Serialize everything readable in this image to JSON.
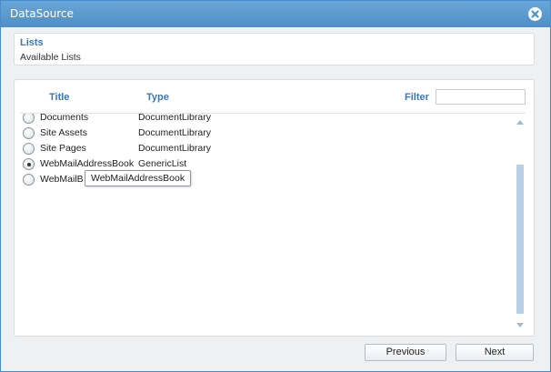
{
  "dialog": {
    "title": "DataSource"
  },
  "lists_panel": {
    "title": "Lists",
    "subtitle": "Available Lists"
  },
  "table": {
    "headers": {
      "title": "Title",
      "type": "Type",
      "filter": "Filter"
    },
    "filter_value": "",
    "rows": [
      {
        "title": "Documents",
        "type": "DocumentLibrary",
        "selected": false
      },
      {
        "title": "Site Assets",
        "type": "DocumentLibrary",
        "selected": false
      },
      {
        "title": "Site Pages",
        "type": "DocumentLibrary",
        "selected": false
      },
      {
        "title": "WebMailAddressBook",
        "type": "GenericList",
        "selected": true
      },
      {
        "title": "WebMailB",
        "type": "",
        "selected": false
      }
    ],
    "tooltip": "WebMailAddressBook"
  },
  "buttons": {
    "previous": "Previous",
    "next": "Next"
  },
  "icons": {
    "close": "close-icon",
    "scroll_up": "scroll-up-icon",
    "scroll_down": "scroll-down-icon"
  },
  "colors": {
    "titlebar": "#4e8fc8",
    "header_text": "#3b77b8",
    "scroll_thumb": "#b9cfe5"
  }
}
